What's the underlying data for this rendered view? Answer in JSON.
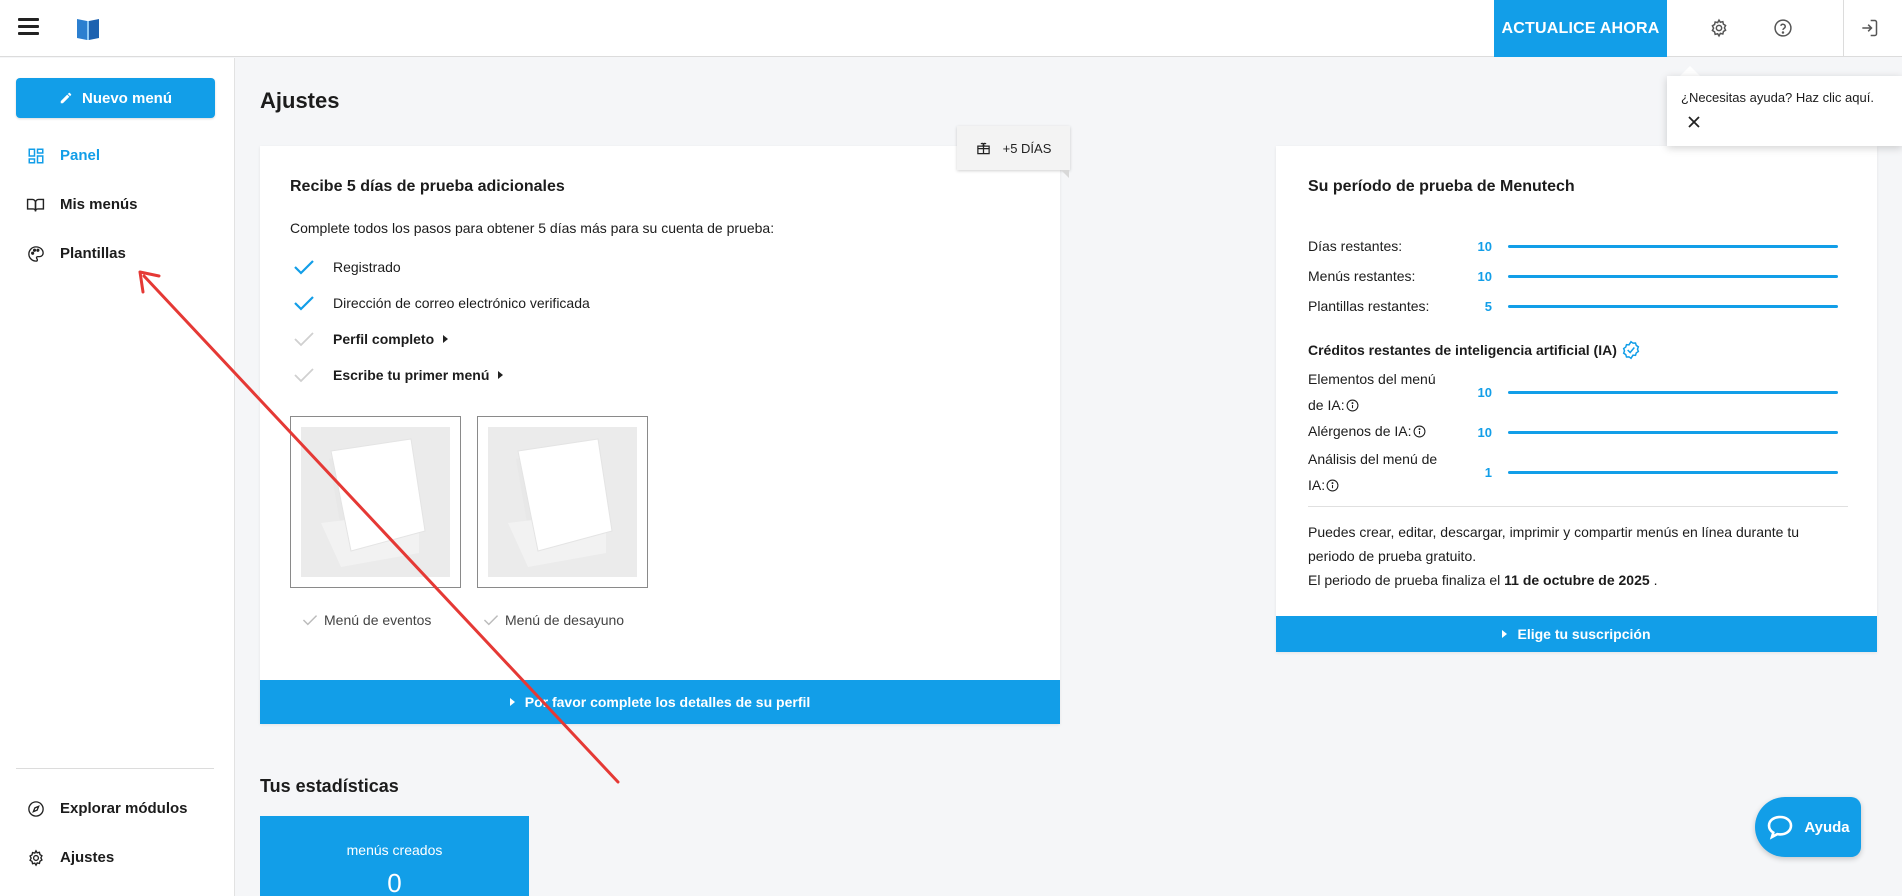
{
  "topbar": {
    "cta_label": "ACTUALICE AHORA"
  },
  "sidebar": {
    "new_menu_label": "Nuevo menú",
    "items": [
      {
        "label": "Panel"
      },
      {
        "label": "Mis menús"
      },
      {
        "label": "Plantillas"
      }
    ],
    "bottom_items": [
      {
        "label": "Explorar módulos"
      },
      {
        "label": "Ajustes"
      }
    ]
  },
  "page": {
    "title": "Ajustes"
  },
  "trial_card": {
    "badge": "+5 DÍAS",
    "title": "Recibe 5 días de prueba adicionales",
    "subtitle": "Complete todos los pasos para obtener 5 días más para su cuenta de prueba:",
    "steps": [
      {
        "label": "Registrado"
      },
      {
        "label": "Dirección de correo electrónico verificada"
      },
      {
        "label": "Perfil completo"
      },
      {
        "label": "Escribe tu primer menú"
      }
    ],
    "thumbnails": [
      {
        "label": "Menú de eventos"
      },
      {
        "label": "Menú de desayuno"
      }
    ],
    "cta": "Por favor complete los detalles de su perfil"
  },
  "period_card": {
    "title": "Su período de prueba de Menutech",
    "rows": [
      {
        "label": "Días restantes:",
        "value": "10"
      },
      {
        "label": "Menús restantes:",
        "value": "10"
      },
      {
        "label": "Plantillas restantes:",
        "value": "5"
      }
    ],
    "ai_title": "Créditos restantes de inteligencia artificial (IA)",
    "ai_rows": [
      {
        "label_line1": "Elementos del menú",
        "label_line2": "de IA:",
        "value": "10"
      },
      {
        "label_line1": "Alérgenos de IA:",
        "label_line2": "",
        "value": "10"
      },
      {
        "label_line1": "Análisis del menú de",
        "label_line2": "IA:",
        "value": "1"
      }
    ],
    "desc_line1": "Puedes crear, editar, descargar, imprimir y compartir menús en línea durante tu",
    "desc_line2": "periodo de prueba gratuito.",
    "end_prefix": "El periodo de prueba finaliza el",
    "end_date": "11 de octubre de 2025",
    "end_suffix": ".",
    "cta": "Elige tu suscripción"
  },
  "stats": {
    "title": "Tus estadísticas",
    "card_label": "menús creados",
    "card_value": "0"
  },
  "tooltip": {
    "text": "¿Necesitas ayuda? Haz clic aquí."
  },
  "help_button": {
    "label": "Ayuda"
  },
  "colors": {
    "accent": "#129ee8",
    "annotation_arrow": "#e53935"
  }
}
